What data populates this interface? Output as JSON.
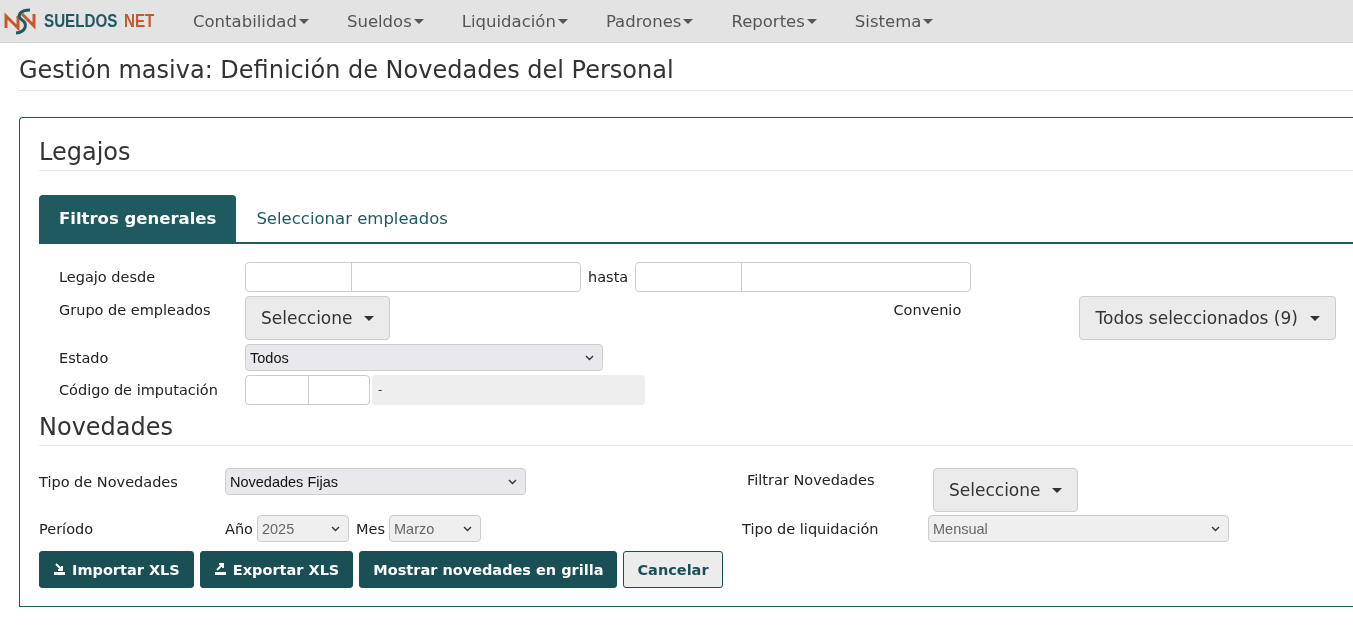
{
  "brand": {
    "part1": "SUELDOS",
    "part2": "NET"
  },
  "menu": [
    {
      "label": "Contabilidad"
    },
    {
      "label": "Sueldos"
    },
    {
      "label": "Liquidación"
    },
    {
      "label": "Padrones"
    },
    {
      "label": "Reportes"
    },
    {
      "label": "Sistema"
    }
  ],
  "page_title": "Gestión masiva: Definición de Novedades del Personal",
  "legajos": {
    "heading": "Legajos",
    "tabs": [
      {
        "label": "Filtros generales",
        "selected": true
      },
      {
        "label": "Seleccionar empleados",
        "selected": false
      }
    ],
    "legajo_desde_label": "Legajo desde",
    "hasta_label": "hasta",
    "grupo_label": "Grupo de empleados",
    "grupo_button": "Seleccione",
    "convenio_label": "Convenio",
    "convenio_button": "Todos seleccionados (9)",
    "estado_label": "Estado",
    "estado_value": "Todos",
    "codigo_label": "Código de imputación",
    "codigo_description": "-"
  },
  "novedades": {
    "heading": "Novedades",
    "tipo_label": "Tipo de Novedades",
    "tipo_value": "Novedades Fijas",
    "filtrar_label": "Filtrar Novedades",
    "filtrar_button": "Seleccione",
    "periodo_label": "Período",
    "anio_label": "Año",
    "anio": {
      "value": "2025",
      "disabled": true
    },
    "mes_label": "Mes",
    "mes": {
      "value": "Marzo",
      "disabled": true
    },
    "liquidacion_label": "Tipo de liquidación",
    "liquidacion": {
      "value": "Mensual",
      "disabled": true
    }
  },
  "buttons": [
    {
      "label": "Importar XLS",
      "kind": "import"
    },
    {
      "label": "Exportar XLS",
      "kind": "export"
    },
    {
      "label": "Mostrar novedades en grilla",
      "kind": "primary"
    },
    {
      "label": "Cancelar",
      "kind": "secondary"
    }
  ]
}
